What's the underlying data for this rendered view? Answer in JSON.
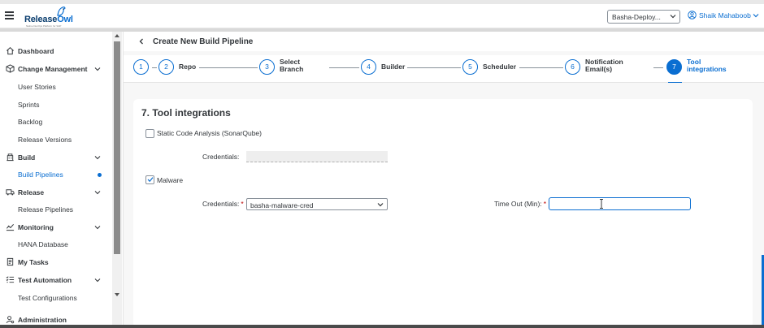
{
  "app": {
    "logo_name_a": "Release",
    "logo_name_b": "Owl",
    "logo_tagline": "Native DevOps Platform for SAP"
  },
  "header": {
    "tenant_value": "Basha-Deploy...",
    "user_name": "Shaik Mahaboob"
  },
  "sidebar": {
    "dashboard": "Dashboard",
    "change_management": "Change Management",
    "user_stories": "User Stories",
    "sprints": "Sprints",
    "backlog": "Backlog",
    "release_versions": "Release Versions",
    "build": "Build",
    "build_pipelines": "Build Pipelines",
    "release": "Release",
    "release_pipelines": "Release Pipelines",
    "monitoring": "Monitoring",
    "hana_database": "HANA Database",
    "my_tasks": "My Tasks",
    "test_automation": "Test Automation",
    "test_configurations": "Test Configurations",
    "administration": "Administration"
  },
  "page": {
    "title": "Create New Build Pipeline"
  },
  "wizard": {
    "steps": [
      {
        "num": "1",
        "label": ""
      },
      {
        "num": "2",
        "label": "Repo"
      },
      {
        "num": "3",
        "label_a": "Select",
        "label_b": "Branch"
      },
      {
        "num": "4",
        "label": "Builder"
      },
      {
        "num": "5",
        "label": "Scheduler"
      },
      {
        "num": "6",
        "label_a": "Notification",
        "label_b": "Email(s)"
      },
      {
        "num": "7",
        "label_a": "Tool",
        "label_b": "integrations"
      }
    ]
  },
  "form": {
    "section_title": "7. Tool integrations",
    "static_code_label": "Static Code Analysis (SonarQube)",
    "static_credentials_label": "Credentials:",
    "malware_label": "Malware",
    "malware_credentials_label": "Credentials:",
    "malware_credentials_value": "basha-malware-cred",
    "timeout_label": "Time Out (Min):",
    "required_mark": "*",
    "timeout_value": ""
  },
  "colors": {
    "accent": "#0a6ed1",
    "required": "#bb0000"
  }
}
